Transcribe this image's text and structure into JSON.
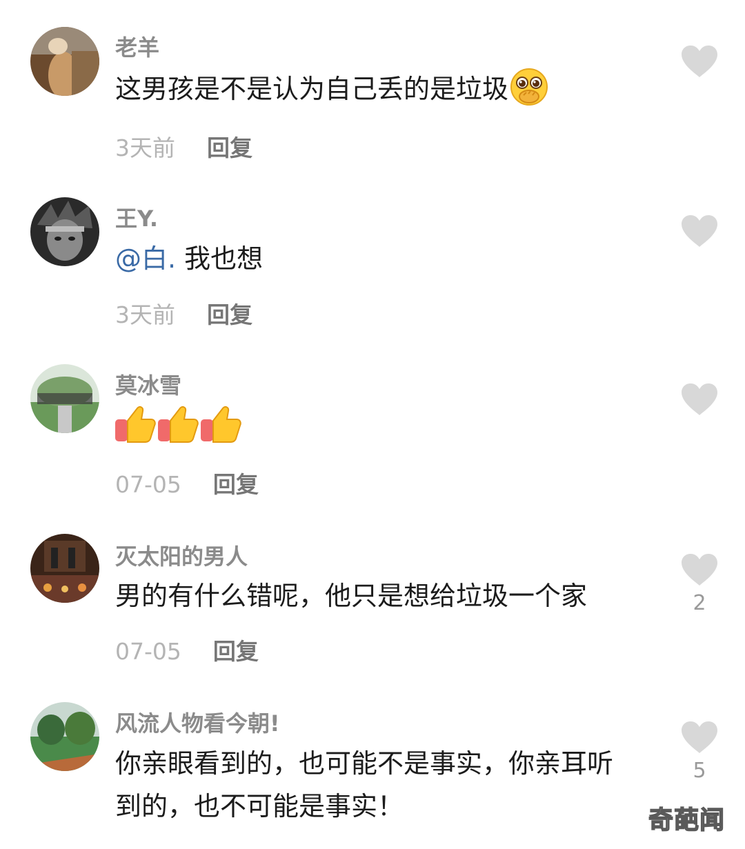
{
  "comments": [
    {
      "username": "老羊",
      "text": "这男孩是不是认为自己丢的是垃圾",
      "emoji": "pleading-face-emoji",
      "time": "3天前",
      "reply": "回复",
      "likes": ""
    },
    {
      "username": "王Y.",
      "mention": "@白.",
      "text": " 我也想",
      "time": "3天前",
      "reply": "回复",
      "likes": ""
    },
    {
      "username": "莫冰雪",
      "emoji": "thumbs-up-emoji x3",
      "time": "07-05",
      "reply": "回复",
      "likes": ""
    },
    {
      "username": "灭太阳的男人",
      "text": "男的有什么错呢，他只是想给垃圾一个家",
      "time": "07-05",
      "reply": "回复",
      "likes": "2"
    },
    {
      "username": "风流人物看今朝!",
      "text_line1": "你亲眼看到的，也可能不是事实，你亲耳听",
      "text_line2": "到的，也不可能是事实！",
      "likes": "5"
    }
  ],
  "watermark": "奇葩闻",
  "colors": {
    "username": "#8b8b8b",
    "text": "#1c1c1c",
    "mention": "#3a6aa6",
    "time": "#b4b4b4",
    "reply": "#767676",
    "heart": "#d8d8d8"
  }
}
